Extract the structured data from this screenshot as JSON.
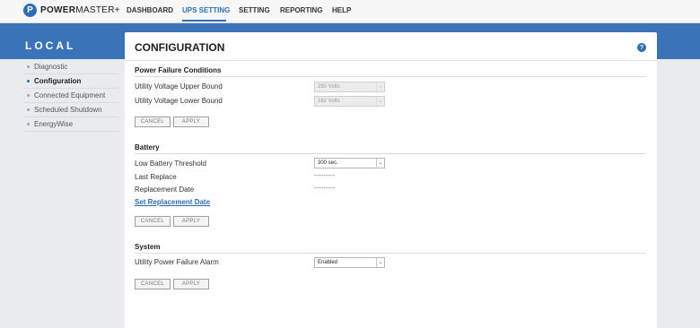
{
  "brand": {
    "name_bold": "POWER",
    "name_rest": "MASTER+",
    "badge": "P"
  },
  "nav": {
    "dashboard": "DASHBOARD",
    "ups_setting": "UPS SETTING",
    "setting": "SETTING",
    "reporting": "REPORTING",
    "help": "HELP"
  },
  "sidebar": {
    "title": "LOCAL",
    "items": [
      {
        "label": "Diagnostic"
      },
      {
        "label": "Configuration"
      },
      {
        "label": "Connected Equipment"
      },
      {
        "label": "Scheduled Shutdown"
      },
      {
        "label": "EnergyWise"
      }
    ],
    "active_index": 1
  },
  "page": {
    "title": "CONFIGURATION",
    "help_glyph": "?"
  },
  "power_failure": {
    "heading": "Power Failure Conditions",
    "upper_label": "Utility Voltage Upper Bound",
    "upper_value": "290 Volts",
    "lower_label": "Utility Voltage Lower Bound",
    "lower_value": "162 Volts",
    "cancel": "CANCEL",
    "apply": "APPLY"
  },
  "battery": {
    "heading": "Battery",
    "threshold_label": "Low Battery Threshold",
    "threshold_value": "300 sec.",
    "last_replace_label": "Last Replace",
    "last_replace_value": "---------",
    "replacement_date_label": "Replacement Date",
    "replacement_date_value": "---------",
    "set_link": "Set Replacement Date",
    "cancel": "CANCEL",
    "apply": "APPLY"
  },
  "system": {
    "heading": "System",
    "alarm_label": "Utility Power Failure Alarm",
    "alarm_value": "Enabled",
    "cancel": "CANCEL",
    "apply": "APPLY"
  },
  "colors": {
    "accent": "#2c6db3",
    "band": "#3b73b8",
    "background": "#e9ebee"
  },
  "icons": {
    "help": "help-icon",
    "dropdown": "chevron-down-icon",
    "logo": "logo-icon"
  }
}
